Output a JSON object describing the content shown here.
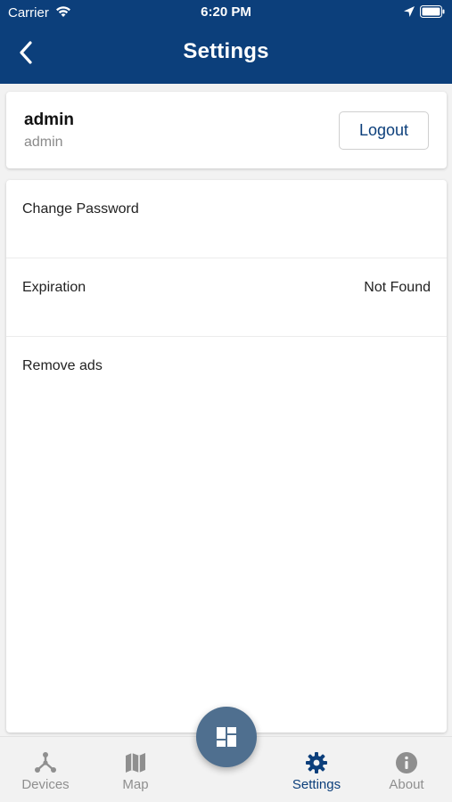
{
  "status_bar": {
    "carrier": "Carrier",
    "time": "6:20 PM"
  },
  "header": {
    "title": "Settings",
    "background_color": "#0c3f7b"
  },
  "user": {
    "name": "admin",
    "subtitle": "admin",
    "logout_label": "Logout"
  },
  "settings": {
    "rows": [
      {
        "label": "Change Password",
        "value": ""
      },
      {
        "label": "Expiration",
        "value": "Not Found"
      },
      {
        "label": "Remove ads",
        "value": ""
      }
    ]
  },
  "tabbar": {
    "tabs": [
      {
        "label": "Devices",
        "icon": "devices-icon"
      },
      {
        "label": "Map",
        "icon": "map-icon"
      },
      {
        "label": "Settings",
        "icon": "gear-icon",
        "active": true
      },
      {
        "label": "About",
        "icon": "info-icon"
      }
    ],
    "fab_icon": "dashboard-grid-icon",
    "active_color": "#0c3f7b",
    "inactive_color": "#8f8f8f"
  }
}
